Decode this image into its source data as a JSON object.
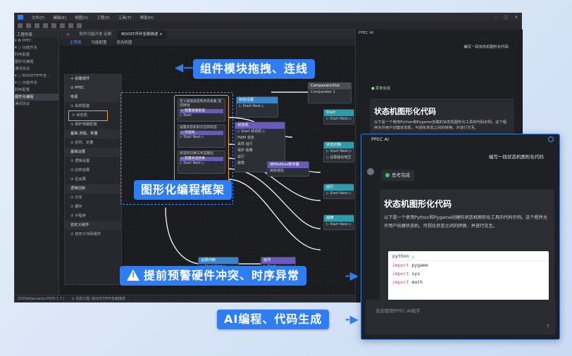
{
  "menu": [
    "文件(F)",
    "编辑(E)",
    "视图(V)",
    "工程(P)",
    "工具(T)",
    "帮助(H)"
  ],
  "sidebar": {
    "title": "工程列表",
    "items": [
      {
        "label": "▾ ✿ PPEC"
      },
      {
        "label": "  ▾ ○ 功能开关"
      },
      {
        "label": "      时序配置"
      },
      {
        "label": "      图形化编程"
      },
      {
        "label": "      通讯协议"
      },
      {
        "label": "  ▾ ○ BOOST开环全..."
      },
      {
        "label": "  ▾ ○ 功能开关"
      },
      {
        "label": "      时序配置"
      },
      {
        "label": "      图形化编程"
      },
      {
        "label": "      通讯协议"
      }
    ]
  },
  "tabs": [
    "软件功能开发 定制",
    "BOOST开环全面描述 ×"
  ],
  "editor": {
    "subtabs": [
      "主界面",
      "功能配置",
      "状态机图"
    ],
    "palette_title": "+ 创建组件"
  },
  "palette": [
    {
      "label": "⊙ PPEC",
      "grp": true
    },
    {
      "label": "电源",
      "grp": true
    },
    {
      "label": "⊙ 采样配置",
      "grp": false
    },
    {
      "label": "⊙ 状态机",
      "grp": false,
      "hl": true
    },
    {
      "label": "⊙ 保护电路配置",
      "grp": false
    },
    {
      "label": "基础 流程、常量",
      "grp": true
    },
    {
      "label": "⊙ 定时、定量",
      "grp": false
    },
    {
      "label": "基础运算",
      "grp": true
    },
    {
      "label": "⊙ 逻辑设置",
      "grp": false
    },
    {
      "label": "⊙ 比较运算",
      "grp": false
    },
    {
      "label": "⊙ 位运算",
      "grp": false
    },
    {
      "label": "逻辑控制",
      "grp": true
    },
    {
      "label": "⊙ 分支",
      "grp": false
    },
    {
      "label": "⊙ 循环",
      "grp": false
    },
    {
      "label": "⊙ 子程序",
      "grp": false
    },
    {
      "label": "自定义组件",
      "grp": true
    },
    {
      "label": "⊙ 自定义代码组件",
      "grp": false
    }
  ],
  "drag_nodes": [
    {
      "t": "定义通道类型和状态采集 提前预测",
      "bar": "◇ 配置通道类型",
      "b": "▷ Start"
    },
    {
      "t": "设置状态机和对应的状态",
      "bar": "◇ 状态机",
      "b": "▷ Start  Next ▷"
    },
    {
      "t": "状态机切换与状态输出",
      "bar": "◇ 配置状态转换",
      "b": "▷ Start  Next ▷"
    }
  ],
  "nodes": [
    {
      "title": "状态设置",
      "color": "blue",
      "lines": [
        "▷ Start   Next ▷"
      ]
    },
    {
      "title": "状态机",
      "color": "purple",
      "lines": [
        "▷ Start   状态机 ▷",
        "PWM    状态",
        "采样    运行",
        "保护    故障",
        "运行",
        "故障"
      ]
    },
    {
      "title": "Start",
      "color": "teal",
      "lines": [
        "▷ Start   Next ▷"
      ]
    },
    {
      "title": "状态切换",
      "color": "teal",
      "lines": [
        "▷ Start   Next ▷",
        "◇ 设置输出电压"
      ]
    },
    {
      "title": "运行",
      "color": "teal",
      "lines": [
        "▷ Start   Next ▷"
      ]
    },
    {
      "title": "故障",
      "color": "teal",
      "lines": [
        "▷ Start   Next ▷"
      ]
    },
    {
      "title": "读Modbus寄存器",
      "color": "purple",
      "lines": [
        "目标地址"
      ]
    },
    {
      "title": "运算判断",
      "color": "blue",
      "lines": [
        "▷ Start   Next ▷"
      ]
    },
    {
      "title": "延时",
      "color": "purple",
      "lines": [
        "▷ Start"
      ]
    },
    {
      "title": "ComparatorOut",
      "color": "gray",
      "lines": [
        "Comparator 1"
      ]
    }
  ],
  "status": [
    "ZSPSAttenuator-PSPS 1.7 |",
    "⊙ 当前工程: BOOST开环全面描述"
  ],
  "ai_back": {
    "header": "PPEC AI",
    "question": "编写一段状态机图形化代码",
    "think": "● 思考完成",
    "title": "状态机图形化代码",
    "body": "以下是一个使用Python和Pygame创建的状态机图形化工具的代码示例。这个程序允许用户创建状态机，可视化状态之间的转换，并进行交互。"
  },
  "ai_front": {
    "header": "PPEC AI",
    "question": "编写一段状态机图形化代码",
    "think": "思考完成",
    "title": "状态机图形化代码",
    "body": "以下是一个使用Python和Pygame创建的状态机图形化工具的代码示例。这个程序允许用户创建状态机，可视化状态之间的转换，并进行交互。",
    "code_lang": "python ⌄",
    "code": [
      {
        "kw": "import",
        "mod": " pygame"
      },
      {
        "kw": "import",
        "mod": " sys"
      },
      {
        "kw": "import",
        "mod": " math"
      }
    ],
    "input_placeholder": "欢迎使用PPEC AI助手",
    "send": "↑"
  },
  "callouts": {
    "drag": "组件模块拖拽、连线",
    "graphic": "图形化编程框架",
    "warn": "提前预警硬件冲突、时序异常",
    "ai": "AI编程、代码生成"
  },
  "colors": {
    "accent": "#2f7df0",
    "highlight": "#f0a13a"
  }
}
